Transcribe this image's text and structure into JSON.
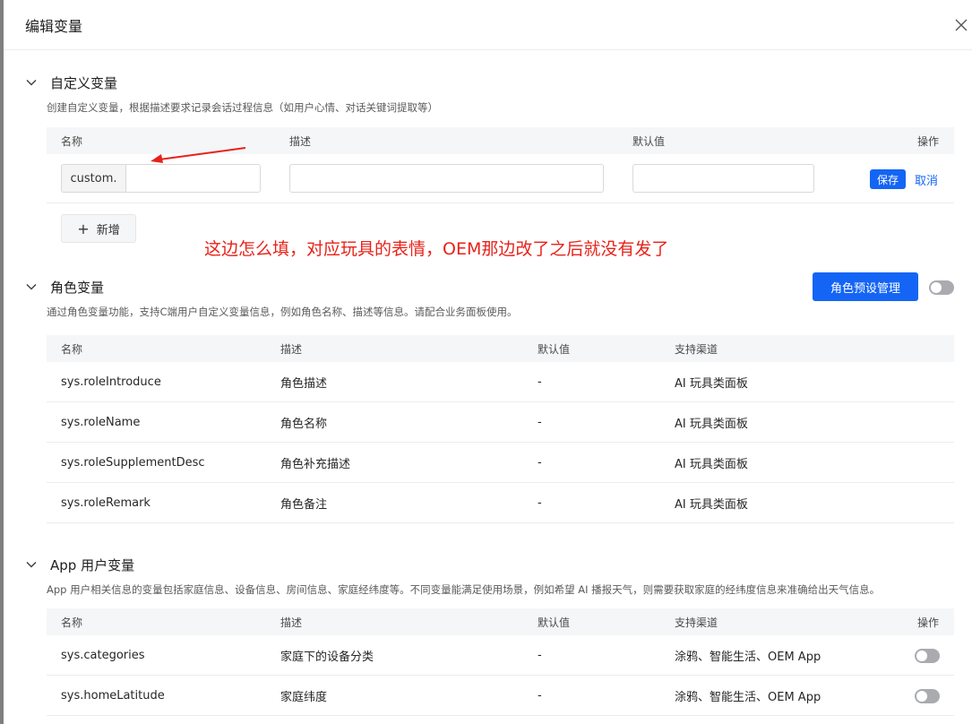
{
  "modal": {
    "title": "编辑变量"
  },
  "custom": {
    "title": "自定义变量",
    "desc": "创建自定义变量，根据描述要求记录会话过程信息（如用户心情、对话关键词提取等）",
    "headers": {
      "name": "名称",
      "desc": "描述",
      "default": "默认值",
      "action": "操作"
    },
    "prefix": "custom.",
    "name_value": "",
    "desc_value": "",
    "default_value": "",
    "save_label": "保存",
    "cancel_label": "取消",
    "add_label": "新增"
  },
  "annotation": "这边怎么填，对应玩具的表情，OEM那边改了之后就没有发了",
  "role": {
    "title": "角色变量",
    "desc": "通过角色变量功能，支持C端用户自定义变量信息，例如角色名称、描述等信息。请配合业务面板使用。",
    "preset_button": "角色预设管理",
    "toggle_on": false,
    "headers": {
      "name": "名称",
      "desc": "描述",
      "default": "默认值",
      "channel": "支持渠道"
    },
    "rows": [
      {
        "name": "sys.roleIntroduce",
        "desc": "角色描述",
        "default": "-",
        "channel": "AI 玩具类面板"
      },
      {
        "name": "sys.roleName",
        "desc": "角色名称",
        "default": "-",
        "channel": "AI 玩具类面板"
      },
      {
        "name": "sys.roleSupplementDesc",
        "desc": "角色补充描述",
        "default": "-",
        "channel": "AI 玩具类面板"
      },
      {
        "name": "sys.roleRemark",
        "desc": "角色备注",
        "default": "-",
        "channel": "AI 玩具类面板"
      }
    ]
  },
  "app": {
    "title": "App 用户变量",
    "desc": "App 用户相关信息的变量包括家庭信息、设备信息、房间信息、家庭经纬度等。不同变量能满足使用场景，例如希望 AI 播报天气，则需要获取家庭的经纬度信息来准确给出天气信息。",
    "headers": {
      "name": "名称",
      "desc": "描述",
      "default": "默认值",
      "channel": "支持渠道",
      "action": "操作"
    },
    "rows": [
      {
        "name": "sys.categories",
        "desc": "家庭下的设备分类",
        "default": "-",
        "channel": "涂鸦、智能生活、OEM App",
        "enabled": false
      },
      {
        "name": "sys.homeLatitude",
        "desc": "家庭纬度",
        "default": "-",
        "channel": "涂鸦、智能生活、OEM App",
        "enabled": false
      }
    ]
  },
  "colors": {
    "primary": "#1465f5",
    "annotation": "#e8221a",
    "toggle_off": "#a9abaf"
  }
}
